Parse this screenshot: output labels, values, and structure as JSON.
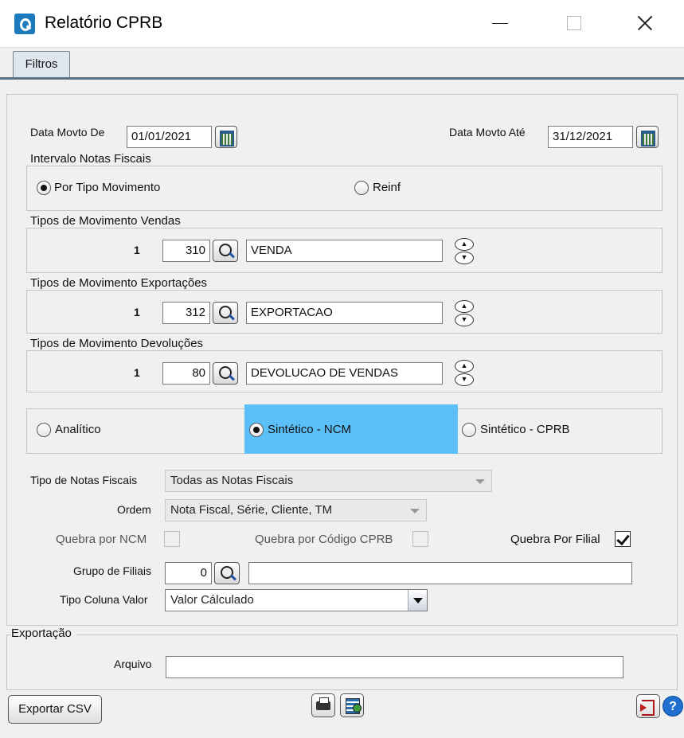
{
  "window": {
    "title": "Relatório CPRB"
  },
  "tabs": [
    {
      "label": "Filtros"
    }
  ],
  "dates": {
    "from_label": "Data Movto De",
    "from_value": "01/01/2021",
    "to_label": "Data Movto Até",
    "to_value": "31/12/2021"
  },
  "intervalo": {
    "title": "Intervalo Notas Fiscais",
    "options": [
      {
        "label": "Por Tipo Movimento",
        "selected": true
      },
      {
        "label": "Reinf",
        "selected": false
      }
    ]
  },
  "movement_groups": [
    {
      "title": "Tipos de Movimento Vendas",
      "index": "1",
      "code": "310",
      "description": "VENDA"
    },
    {
      "title": "Tipos de Movimento Exportações",
      "index": "1",
      "code": "312",
      "description": "EXPORTACAO"
    },
    {
      "title": "Tipos de Movimento Devoluções",
      "index": "1",
      "code": "80",
      "description": "DEVOLUCAO DE VENDAS"
    }
  ],
  "report_type": {
    "options": [
      {
        "label": "Analítico",
        "selected": false
      },
      {
        "label": "Sintético - NCM",
        "selected": true
      },
      {
        "label": "Sintético - CPRB",
        "selected": false
      }
    ]
  },
  "filters": {
    "tipo_notas_label": "Tipo de Notas Fiscais",
    "tipo_notas_value": "Todas as Notas Fiscais",
    "ordem_label": "Ordem",
    "ordem_value": "Nota Fiscal, Série, Cliente, TM",
    "quebra_ncm_label": "Quebra por NCM",
    "quebra_ncm_checked": false,
    "quebra_cprb_label": "Quebra por Código CPRB",
    "quebra_cprb_checked": false,
    "quebra_filial_label": "Quebra Por Filial",
    "quebra_filial_checked": true,
    "grupo_filiais_label": "Grupo de Filiais",
    "grupo_filiais_code": "0",
    "grupo_filiais_desc": "",
    "tipo_coluna_label": "Tipo Coluna Valor",
    "tipo_coluna_value": "Valor Cálculado"
  },
  "export": {
    "title": "Exportação",
    "arquivo_label": "Arquivo",
    "arquivo_value": ""
  },
  "footer": {
    "export_csv_label": "Exportar CSV",
    "help_label": "?"
  },
  "colors": {
    "highlight": "#5bc0f8",
    "tab_border": "#5a7083"
  }
}
